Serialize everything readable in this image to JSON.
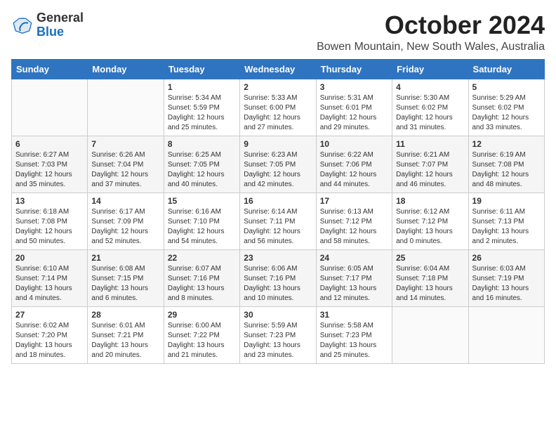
{
  "logo": {
    "general": "General",
    "blue": "Blue"
  },
  "title": "October 2024",
  "subtitle": "Bowen Mountain, New South Wales, Australia",
  "days_of_week": [
    "Sunday",
    "Monday",
    "Tuesday",
    "Wednesday",
    "Thursday",
    "Friday",
    "Saturday"
  ],
  "weeks": [
    [
      {
        "day": "",
        "info": ""
      },
      {
        "day": "",
        "info": ""
      },
      {
        "day": "1",
        "info": "Sunrise: 5:34 AM\nSunset: 5:59 PM\nDaylight: 12 hours\nand 25 minutes."
      },
      {
        "day": "2",
        "info": "Sunrise: 5:33 AM\nSunset: 6:00 PM\nDaylight: 12 hours\nand 27 minutes."
      },
      {
        "day": "3",
        "info": "Sunrise: 5:31 AM\nSunset: 6:01 PM\nDaylight: 12 hours\nand 29 minutes."
      },
      {
        "day": "4",
        "info": "Sunrise: 5:30 AM\nSunset: 6:02 PM\nDaylight: 12 hours\nand 31 minutes."
      },
      {
        "day": "5",
        "info": "Sunrise: 5:29 AM\nSunset: 6:02 PM\nDaylight: 12 hours\nand 33 minutes."
      }
    ],
    [
      {
        "day": "6",
        "info": "Sunrise: 6:27 AM\nSunset: 7:03 PM\nDaylight: 12 hours\nand 35 minutes."
      },
      {
        "day": "7",
        "info": "Sunrise: 6:26 AM\nSunset: 7:04 PM\nDaylight: 12 hours\nand 37 minutes."
      },
      {
        "day": "8",
        "info": "Sunrise: 6:25 AM\nSunset: 7:05 PM\nDaylight: 12 hours\nand 40 minutes."
      },
      {
        "day": "9",
        "info": "Sunrise: 6:23 AM\nSunset: 7:05 PM\nDaylight: 12 hours\nand 42 minutes."
      },
      {
        "day": "10",
        "info": "Sunrise: 6:22 AM\nSunset: 7:06 PM\nDaylight: 12 hours\nand 44 minutes."
      },
      {
        "day": "11",
        "info": "Sunrise: 6:21 AM\nSunset: 7:07 PM\nDaylight: 12 hours\nand 46 minutes."
      },
      {
        "day": "12",
        "info": "Sunrise: 6:19 AM\nSunset: 7:08 PM\nDaylight: 12 hours\nand 48 minutes."
      }
    ],
    [
      {
        "day": "13",
        "info": "Sunrise: 6:18 AM\nSunset: 7:08 PM\nDaylight: 12 hours\nand 50 minutes."
      },
      {
        "day": "14",
        "info": "Sunrise: 6:17 AM\nSunset: 7:09 PM\nDaylight: 12 hours\nand 52 minutes."
      },
      {
        "day": "15",
        "info": "Sunrise: 6:16 AM\nSunset: 7:10 PM\nDaylight: 12 hours\nand 54 minutes."
      },
      {
        "day": "16",
        "info": "Sunrise: 6:14 AM\nSunset: 7:11 PM\nDaylight: 12 hours\nand 56 minutes."
      },
      {
        "day": "17",
        "info": "Sunrise: 6:13 AM\nSunset: 7:12 PM\nDaylight: 12 hours\nand 58 minutes."
      },
      {
        "day": "18",
        "info": "Sunrise: 6:12 AM\nSunset: 7:12 PM\nDaylight: 13 hours\nand 0 minutes."
      },
      {
        "day": "19",
        "info": "Sunrise: 6:11 AM\nSunset: 7:13 PM\nDaylight: 13 hours\nand 2 minutes."
      }
    ],
    [
      {
        "day": "20",
        "info": "Sunrise: 6:10 AM\nSunset: 7:14 PM\nDaylight: 13 hours\nand 4 minutes."
      },
      {
        "day": "21",
        "info": "Sunrise: 6:08 AM\nSunset: 7:15 PM\nDaylight: 13 hours\nand 6 minutes."
      },
      {
        "day": "22",
        "info": "Sunrise: 6:07 AM\nSunset: 7:16 PM\nDaylight: 13 hours\nand 8 minutes."
      },
      {
        "day": "23",
        "info": "Sunrise: 6:06 AM\nSunset: 7:16 PM\nDaylight: 13 hours\nand 10 minutes."
      },
      {
        "day": "24",
        "info": "Sunrise: 6:05 AM\nSunset: 7:17 PM\nDaylight: 13 hours\nand 12 minutes."
      },
      {
        "day": "25",
        "info": "Sunrise: 6:04 AM\nSunset: 7:18 PM\nDaylight: 13 hours\nand 14 minutes."
      },
      {
        "day": "26",
        "info": "Sunrise: 6:03 AM\nSunset: 7:19 PM\nDaylight: 13 hours\nand 16 minutes."
      }
    ],
    [
      {
        "day": "27",
        "info": "Sunrise: 6:02 AM\nSunset: 7:20 PM\nDaylight: 13 hours\nand 18 minutes."
      },
      {
        "day": "28",
        "info": "Sunrise: 6:01 AM\nSunset: 7:21 PM\nDaylight: 13 hours\nand 20 minutes."
      },
      {
        "day": "29",
        "info": "Sunrise: 6:00 AM\nSunset: 7:22 PM\nDaylight: 13 hours\nand 21 minutes."
      },
      {
        "day": "30",
        "info": "Sunrise: 5:59 AM\nSunset: 7:23 PM\nDaylight: 13 hours\nand 23 minutes."
      },
      {
        "day": "31",
        "info": "Sunrise: 5:58 AM\nSunset: 7:23 PM\nDaylight: 13 hours\nand 25 minutes."
      },
      {
        "day": "",
        "info": ""
      },
      {
        "day": "",
        "info": ""
      }
    ]
  ]
}
